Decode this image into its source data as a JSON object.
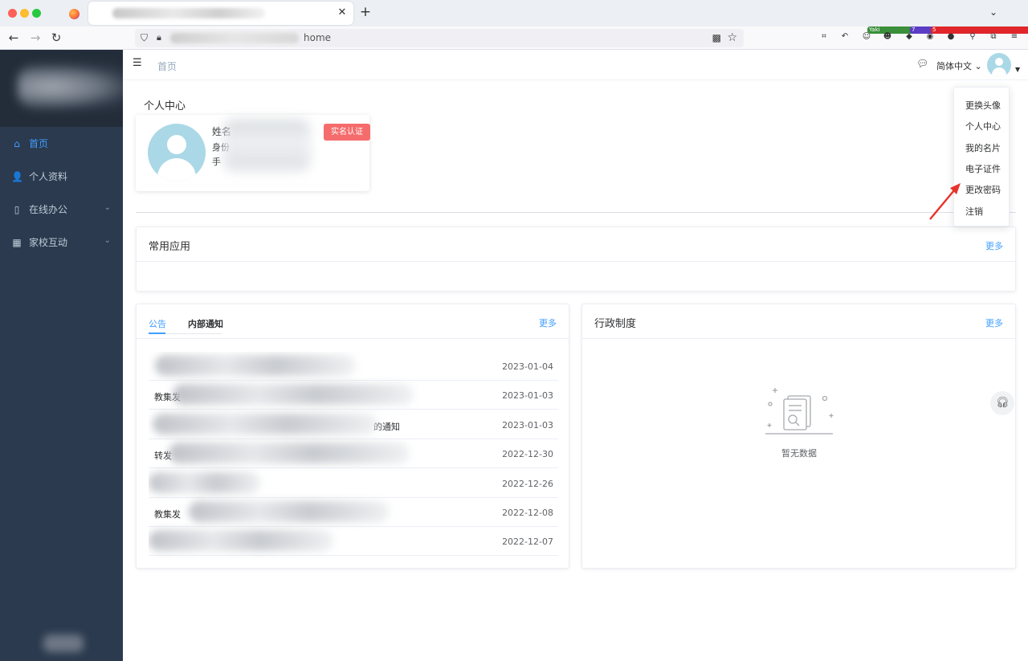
{
  "browser": {
    "url_text": "home",
    "extensions": [
      {
        "name": "crop-icon",
        "glyph": "⌗",
        "badge": ""
      },
      {
        "name": "undo-arrow-icon",
        "glyph": "↶",
        "badge": ""
      },
      {
        "name": "yaki-extension-icon",
        "glyph": "☺",
        "badge": "Yaki"
      },
      {
        "name": "robot-extension-icon",
        "glyph": "☻",
        "badge": ""
      },
      {
        "name": "purple-extension-icon",
        "glyph": "◆",
        "badge": "7"
      },
      {
        "name": "red-badge-extension-icon",
        "glyph": "◉",
        "badge": "5"
      },
      {
        "name": "cookie-extension-icon",
        "glyph": "●",
        "badge": ""
      },
      {
        "name": "pin-extension-icon",
        "glyph": "⚲",
        "badge": ""
      },
      {
        "name": "puzzle-extension-icon",
        "glyph": "⧉",
        "badge": ""
      },
      {
        "name": "app-menu-icon",
        "glyph": "≡",
        "badge": ""
      }
    ]
  },
  "sidebar": {
    "items": [
      {
        "label": "首页",
        "icon": "home-icon",
        "glyph": "⌂",
        "has_arrow": false
      },
      {
        "label": "个人资料",
        "icon": "user-icon",
        "glyph": "👤",
        "has_arrow": false
      },
      {
        "label": "在线办公",
        "icon": "mouse-icon",
        "glyph": "▯",
        "has_arrow": true
      },
      {
        "label": "家校互动",
        "icon": "building-icon",
        "glyph": "▦",
        "has_arrow": true
      }
    ]
  },
  "header": {
    "breadcrumb": "首页",
    "language": "简体中文"
  },
  "profile": {
    "section_title": "个人中心",
    "name_label": "姓名",
    "id_label": "身份",
    "phone_label": "手",
    "verify_button": "实名认证"
  },
  "apps_card": {
    "title": "常用应用",
    "more": "更多"
  },
  "notice_card": {
    "tabs": [
      "公告",
      "内部通知"
    ],
    "more": "更多",
    "rows": [
      {
        "title": "",
        "date": "2023-01-04"
      },
      {
        "title": "教集发",
        "date": "2023-01-03"
      },
      {
        "title": "的通知",
        "date": "2023-01-03"
      },
      {
        "title": "转发",
        "date": "2022-12-30"
      },
      {
        "title": "",
        "date": "2022-12-26"
      },
      {
        "title": "教集发",
        "date": "2022-12-08"
      },
      {
        "title": "",
        "date": "2022-12-07"
      },
      {
        "title": "",
        "date": ""
      }
    ]
  },
  "policy_card": {
    "title": "行政制度",
    "more": "更多",
    "empty_text": "暂无数据"
  },
  "dropdown": {
    "items": [
      "更换头像",
      "个人中心",
      "我的名片",
      "电子证件",
      "更改密码",
      "注销"
    ]
  },
  "colors": {
    "sidebar_bg": "#2b3a4e",
    "accent": "#409eff",
    "danger": "#f56c6c",
    "annotation_arrow": "#e8332a"
  }
}
